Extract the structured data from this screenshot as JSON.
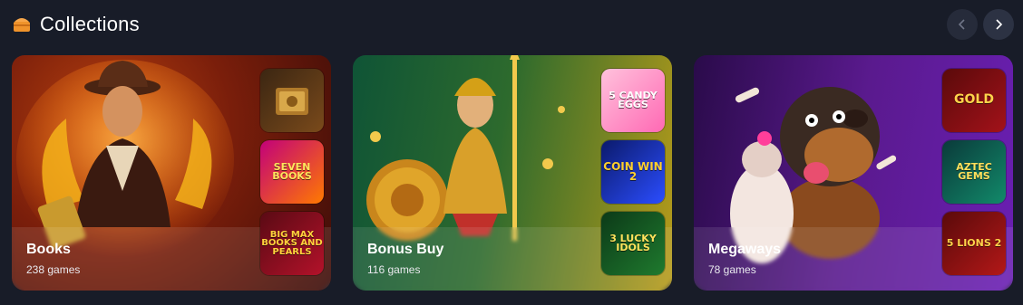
{
  "header": {
    "title": "Collections",
    "icon": "treasure-chest-icon",
    "prev_icon": "chevron-left-icon",
    "next_icon": "chevron-right-icon"
  },
  "colors": {
    "background": "#181c28",
    "accent": "#f0932b"
  },
  "collections": [
    {
      "title": "Books",
      "count": "238 games",
      "thumbs": [
        {
          "name": "Book of Secrets",
          "text": ""
        },
        {
          "name": "Seven Books Unlimited",
          "text": "SEVEN BOOKS"
        },
        {
          "name": "Big Max Books and Pearls",
          "text": "BIG MAX BOOKS AND PEARLS"
        }
      ]
    },
    {
      "title": "Bonus Buy",
      "count": "116 games",
      "thumbs": [
        {
          "name": "5 Candy Eggs",
          "text": "5 CANDY EGGS"
        },
        {
          "name": "Coin Win 2",
          "text": "COIN WIN 2"
        },
        {
          "name": "3 Lucky Idols",
          "text": "3 LUCKY IDOLS"
        }
      ]
    },
    {
      "title": "Megaways",
      "count": "78 games",
      "thumbs": [
        {
          "name": "Gold Megaways",
          "text": "GOLD"
        },
        {
          "name": "Aztec Gems Megaways",
          "text": "AZTEC GEMS"
        },
        {
          "name": "5 Lions Megaways 2",
          "text": "5 LIONS 2"
        }
      ]
    }
  ]
}
